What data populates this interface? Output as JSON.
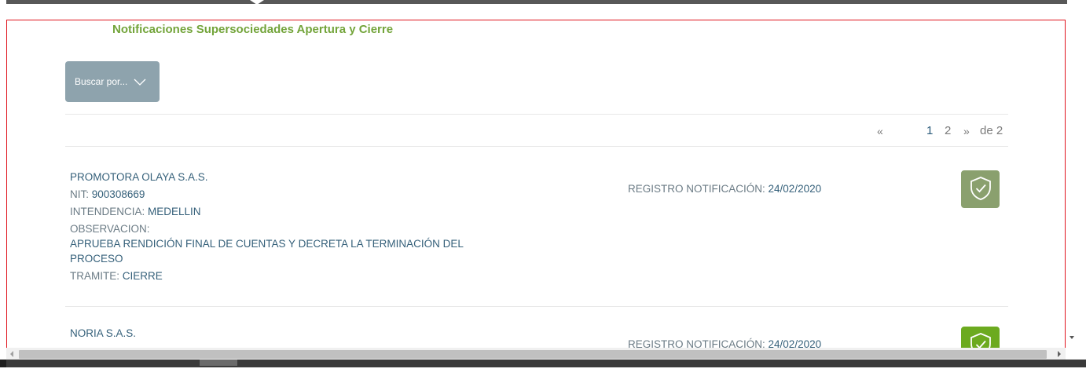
{
  "header": {
    "title": "Notificaciones Supersociedades Apertura y Cierre"
  },
  "search": {
    "label": "Buscar por..."
  },
  "pagination": {
    "prev": "«",
    "pages": [
      "1",
      "2"
    ],
    "current": "1",
    "next": "»",
    "total_label": "de 2"
  },
  "labels": {
    "nit": "NIT:",
    "intendencia": "INTENDENCIA:",
    "observacion": "OBSERVACION:",
    "tramite": "TRAMITE:",
    "registro": "REGISTRO NOTIFICACIÓN:"
  },
  "records": [
    {
      "company": "PROMOTORA OLAYA S.A.S.",
      "nit": "900308669",
      "intendencia": "MEDELLIN",
      "observacion": "APRUEBA RENDICIÓN FINAL DE CUENTAS Y DECRETA LA TERMINACIÓN DEL PROCESO",
      "tramite": "CIERRE",
      "registro": "24/02/2020",
      "badge_icon": "shield-check-icon",
      "badge_color": "#8aa06e"
    },
    {
      "company": "NORIA S.A.S.",
      "registro": "24/02/2020",
      "badge_icon": "shield-check-icon",
      "badge_color": "#6caa1f"
    }
  ],
  "colors": {
    "title": "#73a43a",
    "button": "#8ea3ad",
    "frame": "#e0141e",
    "value_text": "#35607a",
    "label_text": "#6b7b85"
  }
}
